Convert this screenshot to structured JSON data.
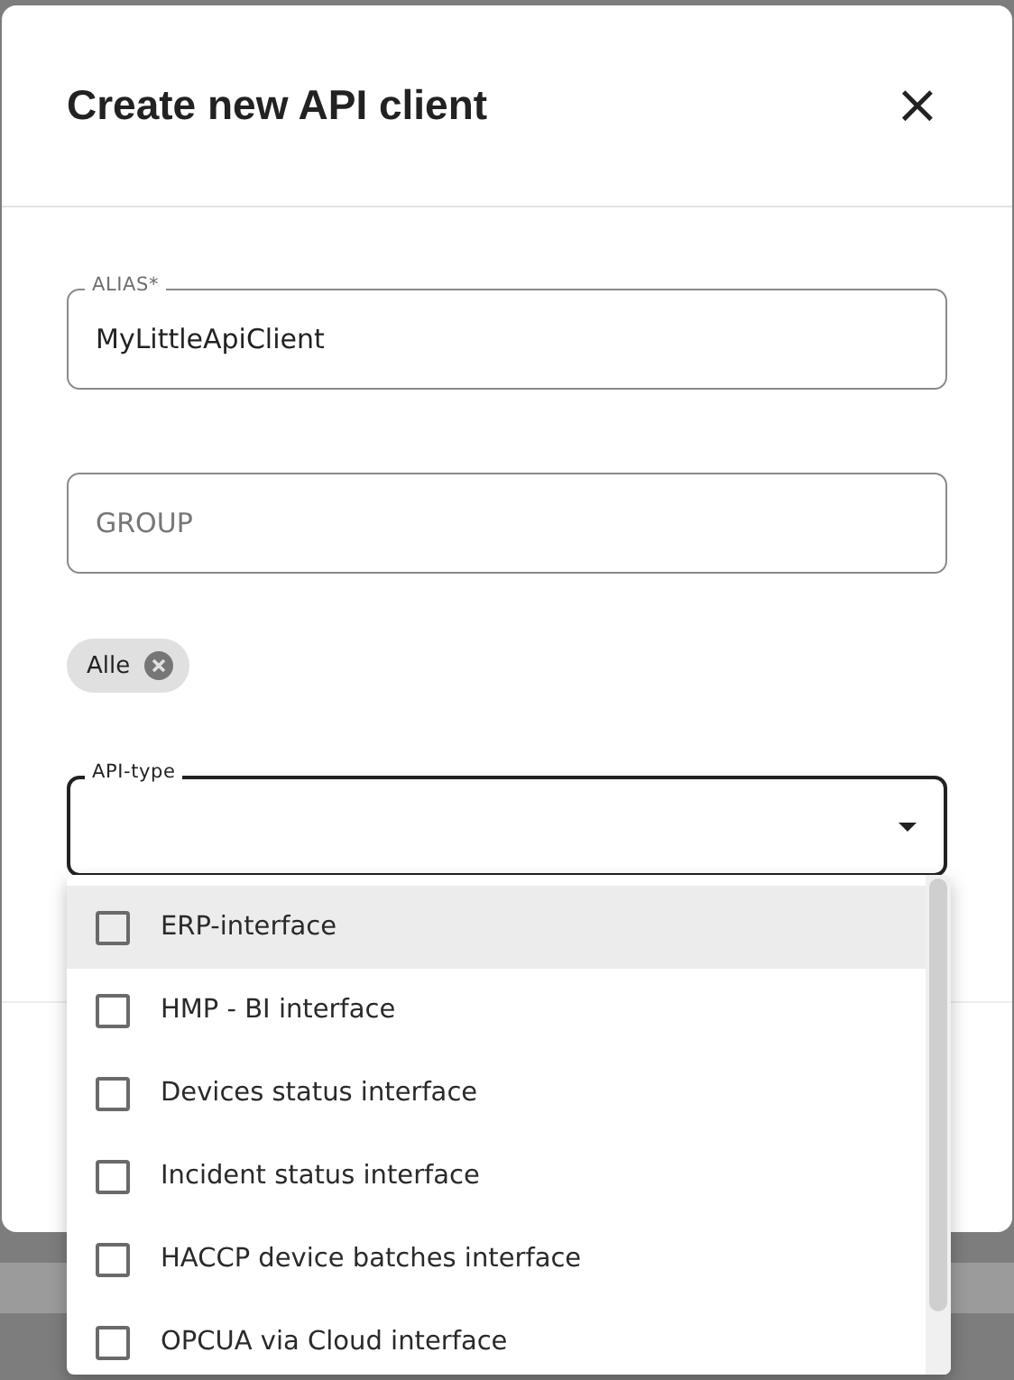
{
  "dialog": {
    "title": "Create new API client",
    "close": "×"
  },
  "alias": {
    "label": "ALIAS*",
    "value": "MyLittleApiClient"
  },
  "group": {
    "placeholder": "GROUP"
  },
  "chips": [
    {
      "label": "Alle"
    }
  ],
  "api_type": {
    "label": "API-type",
    "expanded": true
  },
  "options": [
    {
      "label": "ERP-interface",
      "checked": false,
      "highlighted": true
    },
    {
      "label": "HMP - BI interface",
      "checked": false,
      "highlighted": false
    },
    {
      "label": "Devices status interface",
      "checked": false,
      "highlighted": false
    },
    {
      "label": "Incident status interface",
      "checked": false,
      "highlighted": false
    },
    {
      "label": "HACCP device batches interface",
      "checked": false,
      "highlighted": false
    },
    {
      "label": "OPCUA via Cloud interface",
      "checked": false,
      "highlighted": false
    }
  ]
}
